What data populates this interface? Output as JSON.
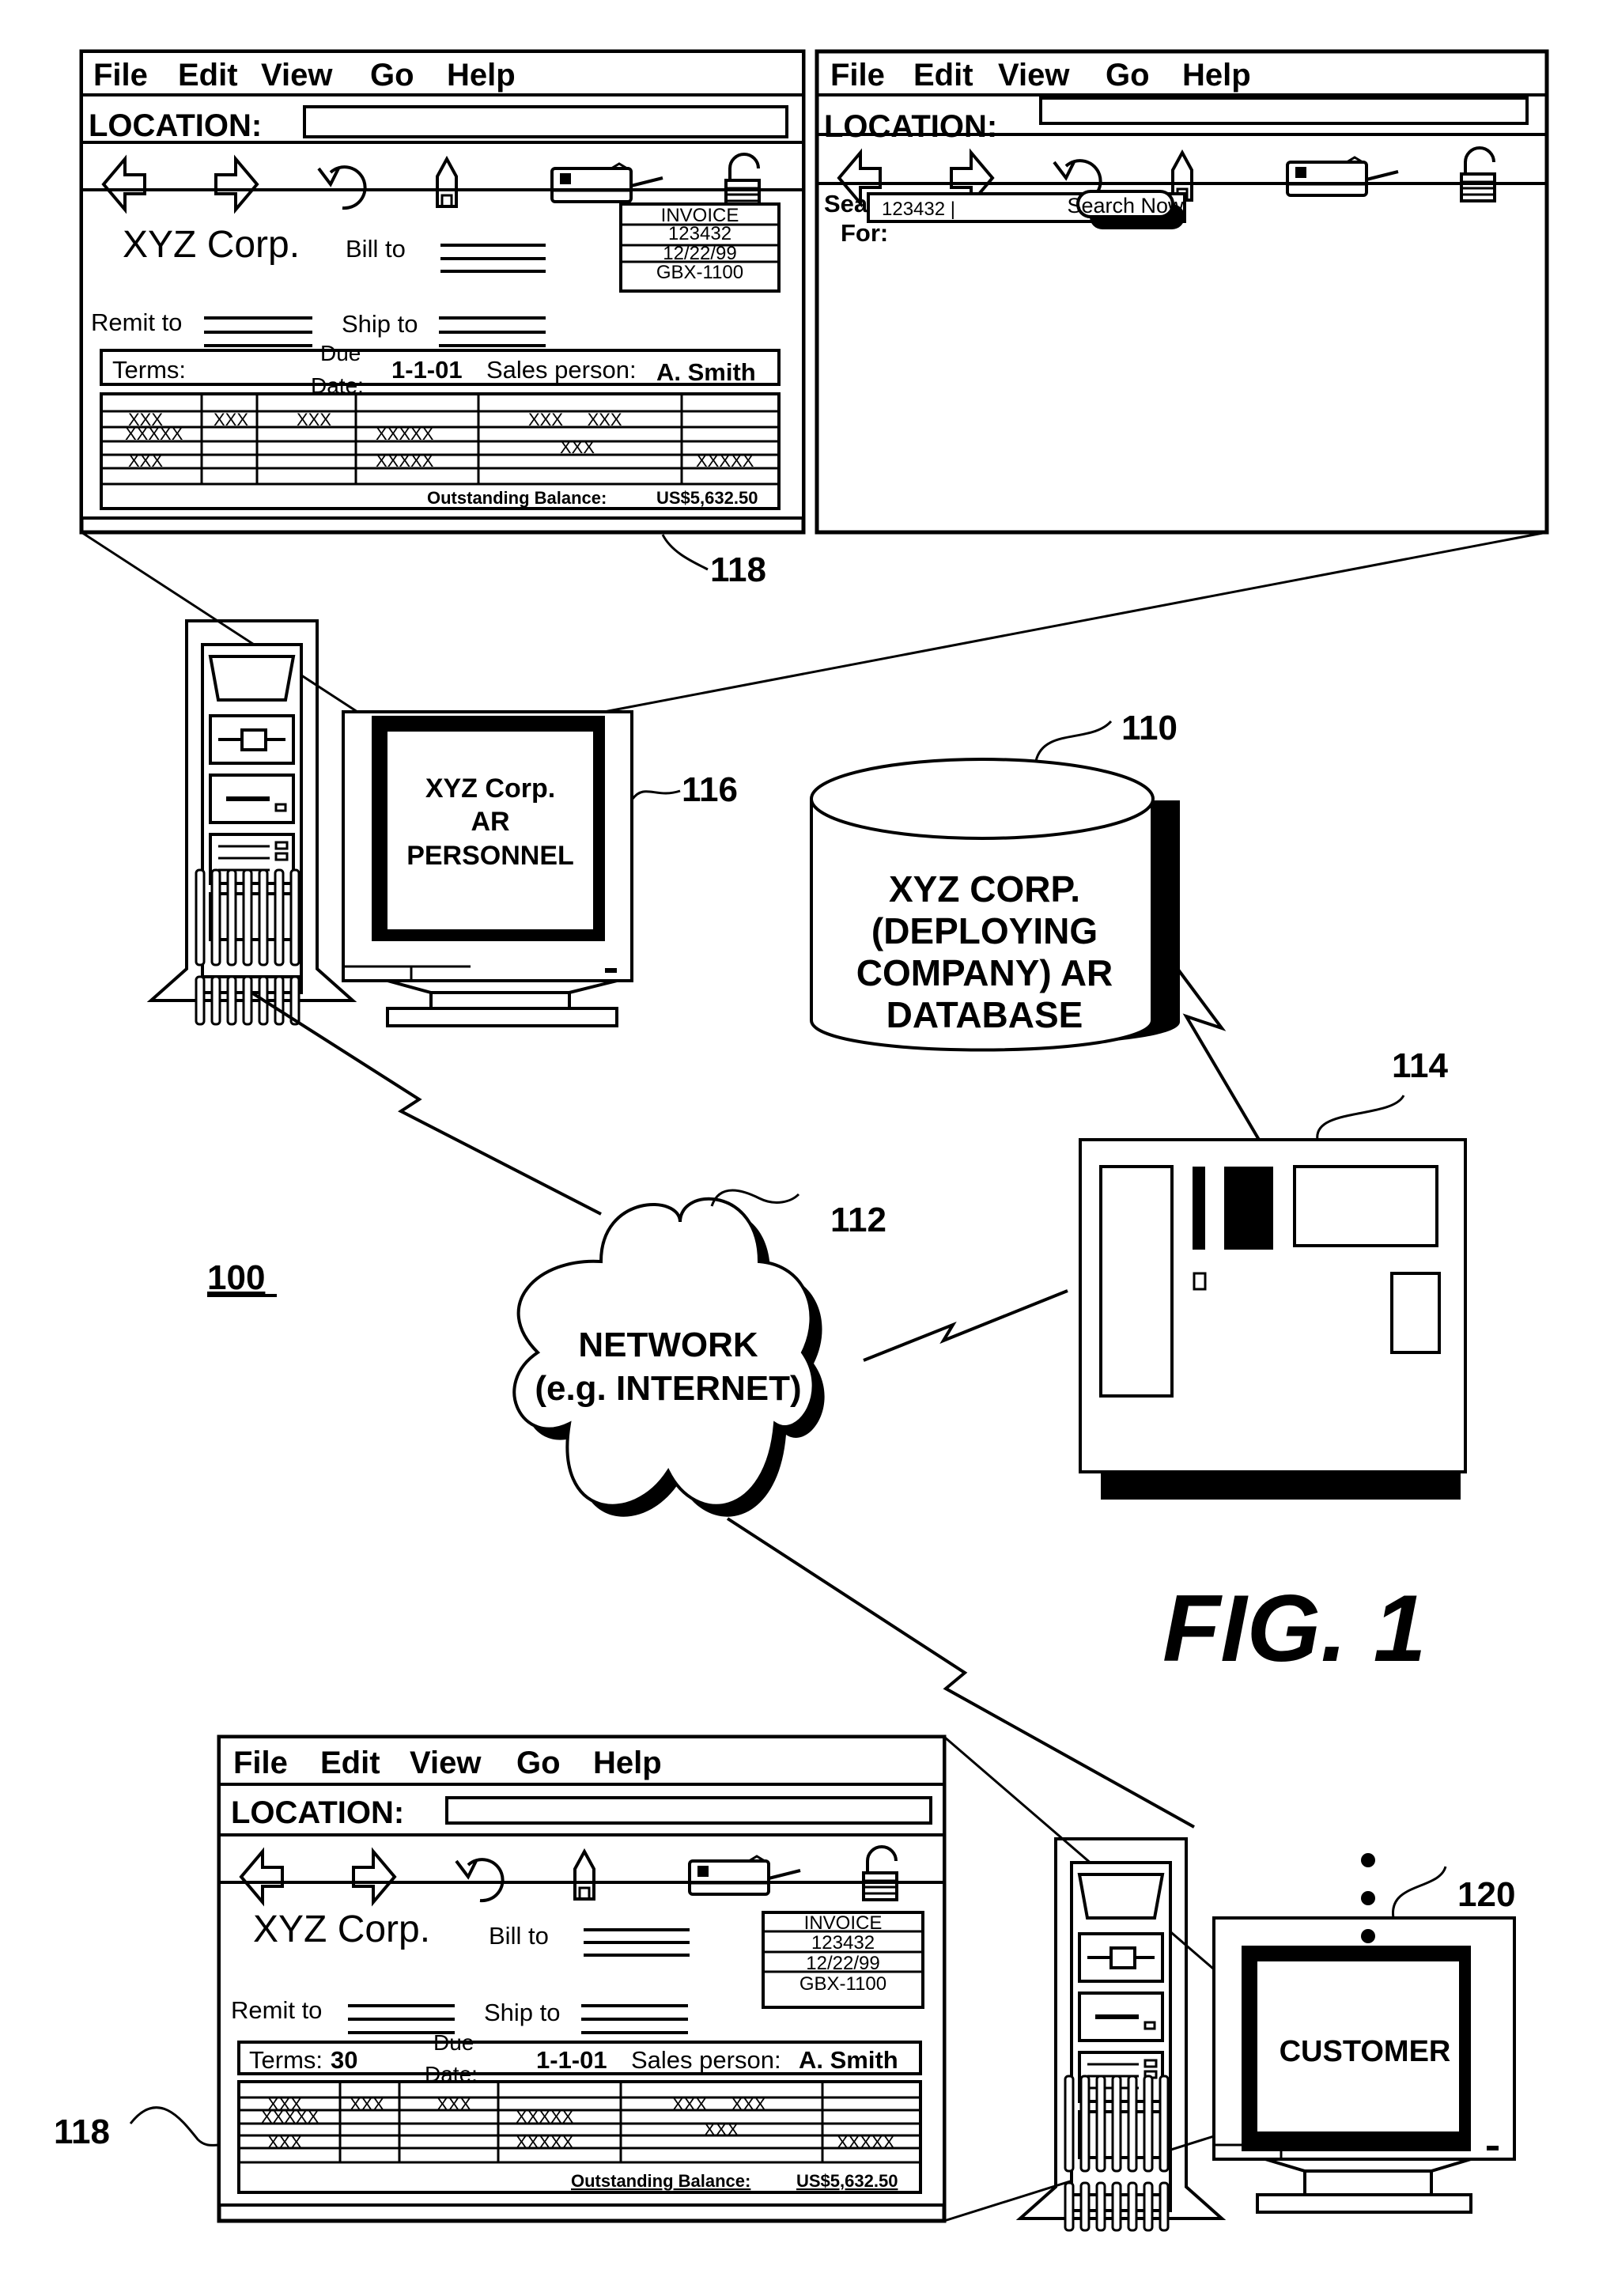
{
  "figure": {
    "title": "FIG. 1",
    "system_ref": "100"
  },
  "browser_menu": [
    "File",
    "Edit",
    "View",
    "Go",
    "Help"
  ],
  "location_label": "LOCATION:",
  "toolbar_icons": [
    "back-arrow-icon",
    "forward-arrow-icon",
    "reload-icon",
    "home-icon",
    "print-icon",
    "security-lock-icon"
  ],
  "invoice_window_top": {
    "ref": "118",
    "location_value": "",
    "company": "XYZ Corp.",
    "bill_to_label": "Bill to",
    "remit_to_label": "Remit to",
    "ship_to_label": "Ship to",
    "invoice_box": [
      "INVOICE",
      "123432",
      "12/22/99",
      "GBX-1100"
    ],
    "terms_label": "Terms:",
    "terms_value": "",
    "due_label_1": "Due",
    "due_label_2": "Date:",
    "due_value": "1-1-01",
    "salesperson_label": "Sales person:",
    "salesperson_value": "A. Smith",
    "table_cells": {
      "r1": [
        "XXX",
        "XXX",
        "XXX",
        "",
        "XXX     XXX",
        ""
      ],
      "r2": [
        "XXXXX",
        "",
        "",
        "XXXXX",
        "",
        ""
      ],
      "r3": [
        "",
        "",
        "",
        "",
        "XXX",
        ""
      ],
      "r4": [
        "XXX",
        "",
        "",
        "XXXXX",
        "",
        "XXXXX"
      ]
    },
    "balance_label": "Outstanding Balance:",
    "balance_value": "US$5,632.50"
  },
  "search_window": {
    "location_value": "",
    "search_label_1": "Search",
    "search_label_2": "For:",
    "search_value": "123432 |",
    "search_button": "Search Now"
  },
  "invoice_window_bottom": {
    "ref": "118",
    "location_value": "",
    "company": "XYZ Corp.",
    "bill_to_label": "Bill to",
    "remit_to_label": "Remit to",
    "ship_to_label": "Ship to",
    "invoice_box": [
      "INVOICE",
      "123432",
      "12/22/99",
      "GBX-1100"
    ],
    "terms_label": "Terms:",
    "terms_value": "30",
    "due_label_1": "Due",
    "due_label_2": "Date:",
    "due_value": "1-1-01",
    "salesperson_label": "Sales person:",
    "salesperson_value": "A. Smith",
    "balance_label": "Outstanding Balance:",
    "balance_value": "US$5,632.50"
  },
  "nodes": {
    "ar_personnel": {
      "ref": "116",
      "screen_lines": [
        "XYZ Corp.",
        "AR",
        "PERSONNEL"
      ]
    },
    "database": {
      "ref": "110",
      "lines": [
        "XYZ CORP.",
        "(DEPLOYING",
        "COMPANY) AR",
        "DATABASE"
      ]
    },
    "server": {
      "ref": "114"
    },
    "network": {
      "ref": "112",
      "lines": [
        "NETWORK",
        "(e.g. INTERNET)"
      ]
    },
    "customer": {
      "ref": "120",
      "screen_text": "CUSTOMER"
    }
  }
}
